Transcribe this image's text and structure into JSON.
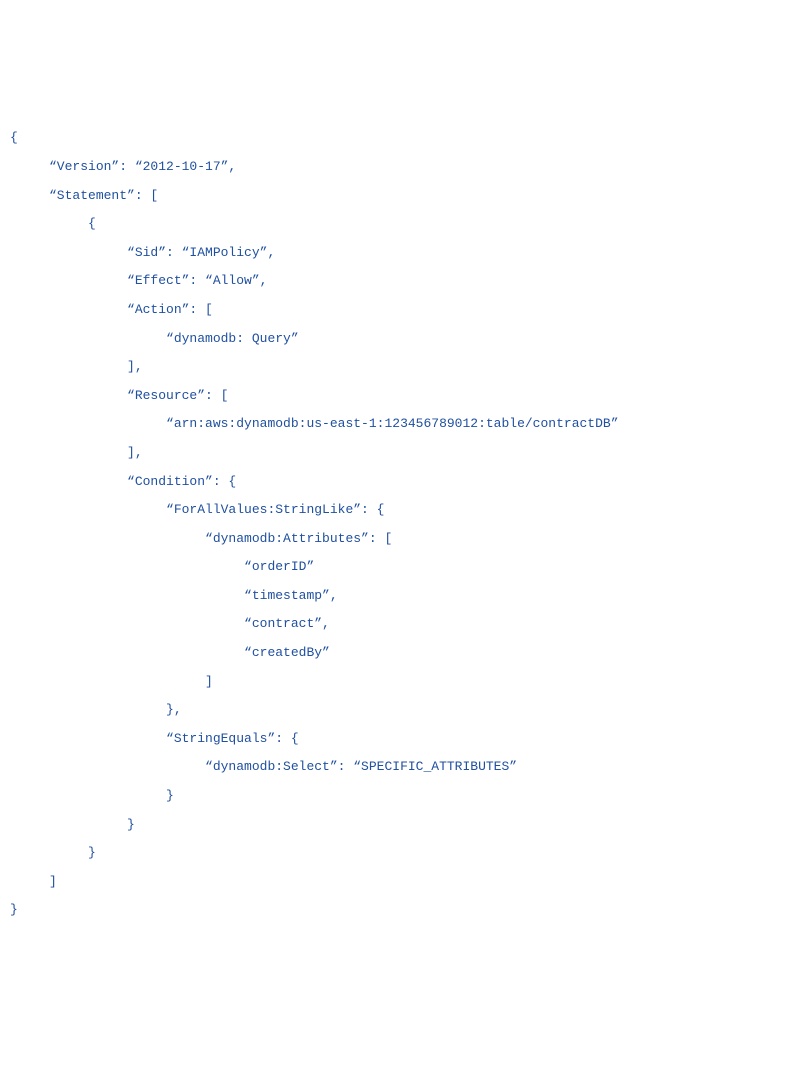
{
  "policy": {
    "line1": "{",
    "line2": "     “Version”: “2012-10-17”,",
    "line3": "     “Statement”: [",
    "line4": "          {",
    "line5": "               “Sid”: “IAMPolicy”,",
    "line6": "               “Effect”: “Allow”,",
    "line7": "               “Action”: [",
    "line8": "                    “dynamodb: Query”",
    "line9": "               ],",
    "line10": "               “Resource”: [",
    "line11": "                    “arn:aws:dynamodb:us-east-1:123456789012:table/contractDB”",
    "line12": "               ],",
    "line13": "               “Condition”: {",
    "line14": "                    “ForAllValues:StringLike”: {",
    "line15": "                         “dynamodb:Attributes”: [",
    "line16": "                              “orderID”",
    "line17": "                              “timestamp”,",
    "line18": "                              “contract”,",
    "line19": "                              “createdBy”",
    "line20": "                         ]",
    "line21": "                    },",
    "line22": "                    “StringEquals”: {",
    "line23": "                         “dynamodb:Select”: “SPECIFIC_ATTRIBUTES”",
    "line24": "                    }",
    "line25": "               }",
    "line26": "          }",
    "line27": "     ]",
    "line28": "}"
  }
}
